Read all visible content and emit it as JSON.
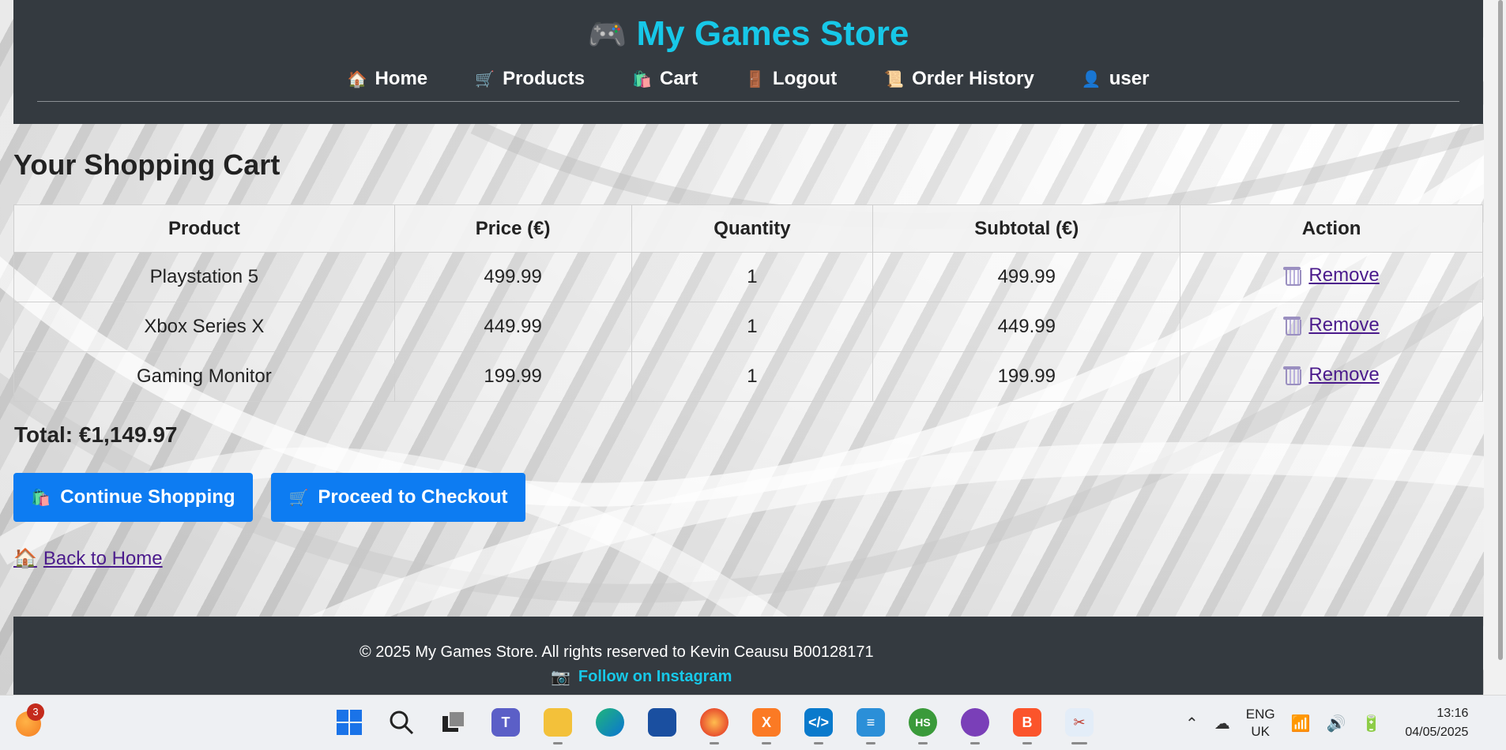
{
  "site": {
    "title": "My Games Store",
    "title_icon": "🎮",
    "nav": [
      {
        "icon": "🏠",
        "label": "Home"
      },
      {
        "icon": "🛒",
        "label": "Products"
      },
      {
        "icon": "🛍️",
        "label": "Cart"
      },
      {
        "icon": "🚪",
        "label": "Logout"
      },
      {
        "icon": "📜",
        "label": "Order History"
      },
      {
        "icon": "👤",
        "label": "user"
      }
    ]
  },
  "cart": {
    "heading": "Your Shopping Cart",
    "columns": [
      "Product",
      "Price (€)",
      "Quantity",
      "Subtotal (€)",
      "Action"
    ],
    "rows": [
      {
        "product": "Playstation 5",
        "price": "499.99",
        "quantity": "1",
        "subtotal": "499.99",
        "action": "Remove"
      },
      {
        "product": "Xbox Series X",
        "price": "449.99",
        "quantity": "1",
        "subtotal": "449.99",
        "action": "Remove"
      },
      {
        "product": "Gaming Monitor",
        "price": "199.99",
        "quantity": "1",
        "subtotal": "199.99",
        "action": "Remove"
      }
    ],
    "total": "Total: €1,149.97",
    "continue_label": "Continue Shopping",
    "continue_icon": "🛍️",
    "checkout_label": "Proceed to Checkout",
    "checkout_icon": "🛒",
    "back_home_label": "Back to Home",
    "back_home_icon": "🏠"
  },
  "footer": {
    "copyright": "© 2025 My Games Store. All rights reserved to Kevin Ceausu B00128171",
    "instagram_icon": "📷",
    "instagram_label": "Follow on Instagram"
  },
  "taskbar": {
    "weather_badge": "3",
    "apps": [
      {
        "name": "start-icon"
      },
      {
        "name": "search-icon"
      },
      {
        "name": "task-view-icon"
      },
      {
        "name": "teams-icon"
      },
      {
        "name": "file-explorer-icon"
      },
      {
        "name": "edge-icon"
      },
      {
        "name": "store-icon"
      },
      {
        "name": "firefox-icon"
      },
      {
        "name": "xampp-icon"
      },
      {
        "name": "vscode-icon"
      },
      {
        "name": "notepad-icon"
      },
      {
        "name": "hs-app-icon",
        "text": "HS"
      },
      {
        "name": "github-icon"
      },
      {
        "name": "brave-icon"
      },
      {
        "name": "snipping-tool-icon"
      }
    ],
    "lang_top": "ENG",
    "lang_bottom": "UK",
    "time": "13:16",
    "date": "04/05/2025"
  },
  "colors": {
    "header_bg": "#343a40",
    "brand_accent": "#17c8e8",
    "button_blue": "#0d7cf2",
    "link_purple": "#4b1b8c"
  }
}
